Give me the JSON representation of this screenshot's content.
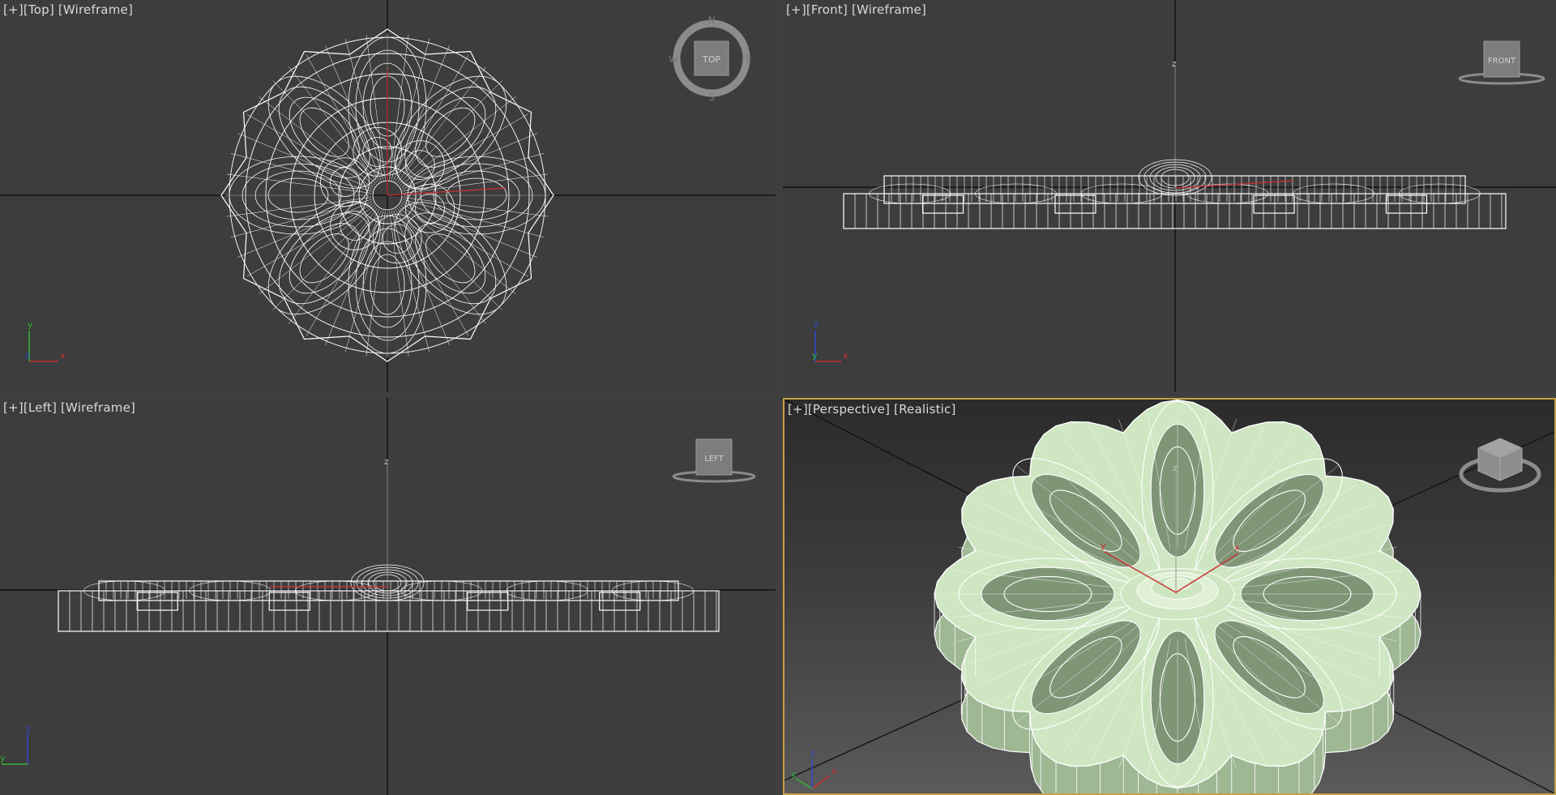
{
  "viewports": {
    "top": {
      "label_plus": "[+]",
      "label_view": "[Top]",
      "label_mode": "[Wireframe]",
      "cube_label": "TOP",
      "compass": {
        "n": "N",
        "s": "S",
        "e": "E",
        "w": "W"
      }
    },
    "front": {
      "label_plus": "[+]",
      "label_view": "[Front]",
      "label_mode": "[Wireframe]",
      "cube_label": "FRONT"
    },
    "left": {
      "label_plus": "[+]",
      "label_view": "[Left]",
      "label_mode": "[Wireframe]",
      "cube_label": "LEFT"
    },
    "perspective": {
      "label_plus": "[+]",
      "label_view": "[Perspective]",
      "label_mode": "[Realistic]",
      "cube_label": "ViewCube",
      "active": true
    }
  },
  "axes": {
    "x": "x",
    "y": "y",
    "z": "z"
  },
  "colors": {
    "viewport_bg": "#3d3d3d",
    "wire": "#ffffff",
    "x_axis": "#c83232",
    "y_axis": "#32b432",
    "z_axis": "#3246d2",
    "active_border": "#c7a047",
    "mesh_fill": "#cfe6c2"
  }
}
